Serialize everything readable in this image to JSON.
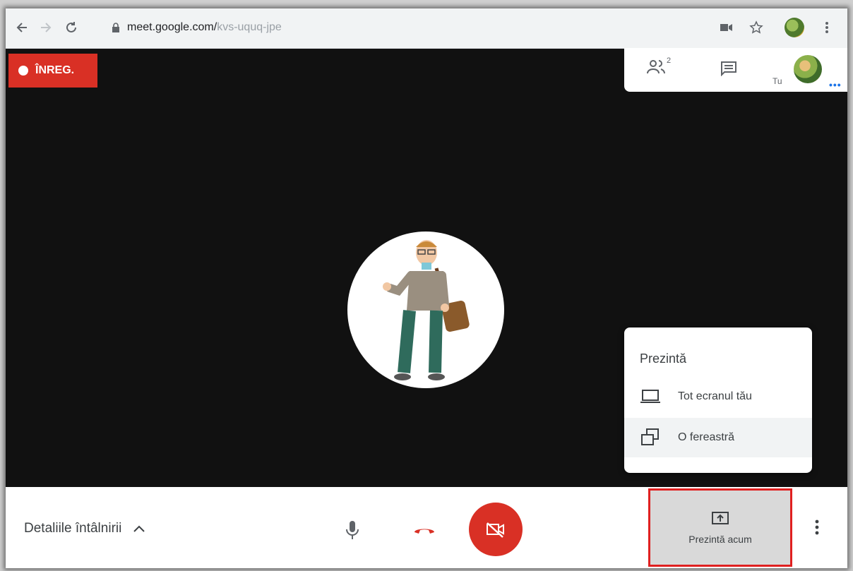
{
  "browser": {
    "url_host": "meet.google.com/",
    "url_path": "kvs-uquq-jpe"
  },
  "meet": {
    "recording_label": "ÎNREG.",
    "participants_count": "2",
    "self_label": "Tu",
    "present_menu": {
      "title": "Prezintă",
      "items": [
        {
          "label": "Tot ecranul tău",
          "icon": "laptop-icon"
        },
        {
          "label": "O fereastră",
          "icon": "window-icon"
        }
      ]
    },
    "bottom": {
      "details_label": "Detaliile întâlnirii",
      "present_now_label": "Prezintă acum"
    }
  },
  "colors": {
    "recording_red": "#d93025",
    "highlight_border": "#e02020"
  }
}
